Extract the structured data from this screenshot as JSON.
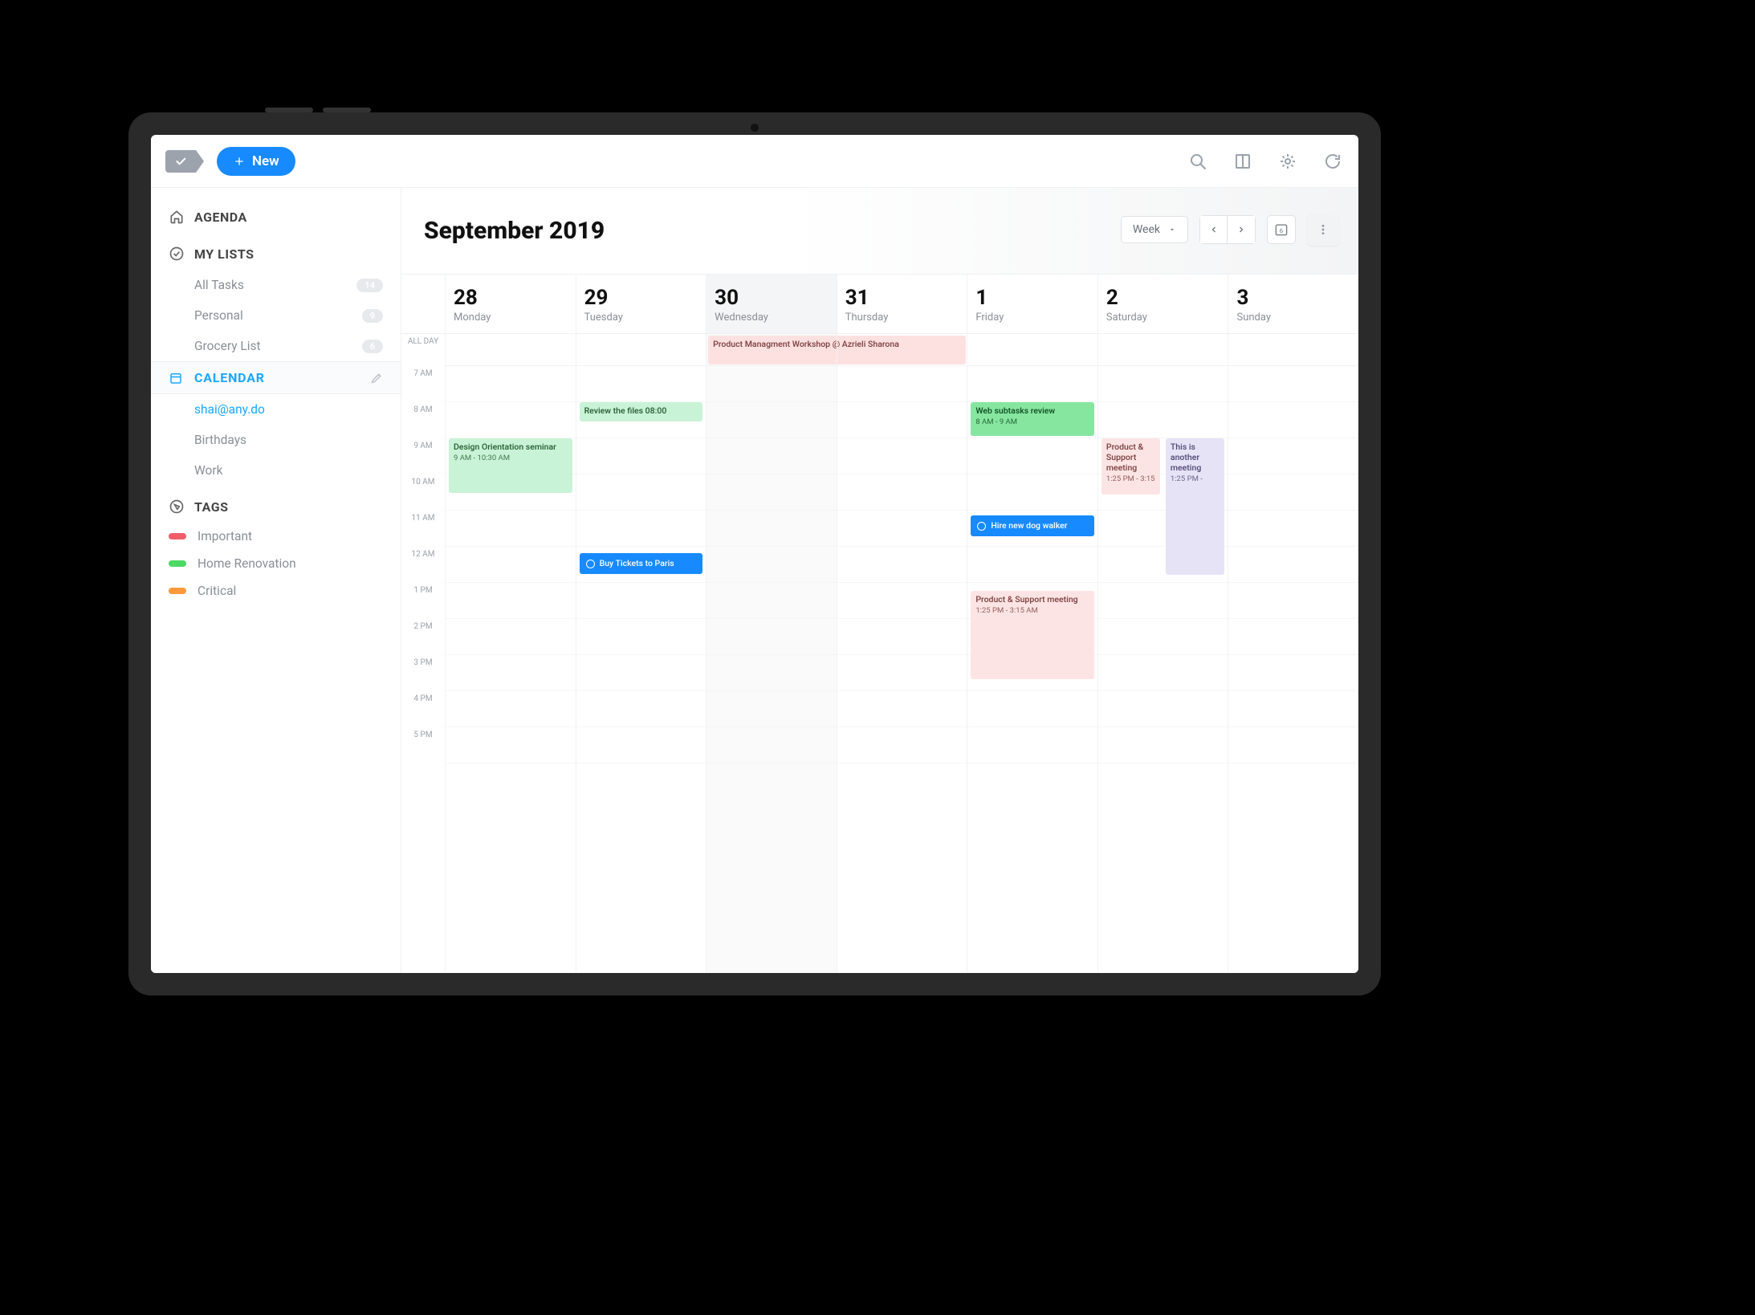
{
  "toolbar": {
    "new_label": "New"
  },
  "sidebar": {
    "agenda_label": "AGENDA",
    "mylists_label": "MY LISTS",
    "lists": [
      {
        "label": "All Tasks",
        "count": "14"
      },
      {
        "label": "Personal",
        "count": "9"
      },
      {
        "label": "Grocery List",
        "count": "6"
      }
    ],
    "calendar_label": "CALENDAR",
    "calendars": [
      {
        "label": "shai@any.do",
        "accent": true
      },
      {
        "label": "Birthdays",
        "accent": false
      },
      {
        "label": "Work",
        "accent": false
      }
    ],
    "tags_label": "TAGS",
    "tags": [
      {
        "label": "Important",
        "color": "#f15d6a"
      },
      {
        "label": "Home Renovation",
        "color": "#4cd964"
      },
      {
        "label": "Critical",
        "color": "#ff9a3c"
      }
    ]
  },
  "calendar": {
    "title": "September 2019",
    "view_label": "Week",
    "today_icon_value": "6",
    "allday_label": "ALL DAY",
    "hours": [
      "7 AM",
      "8 AM",
      "9 AM",
      "10 AM",
      "11 AM",
      "12 AM",
      "1 PM",
      "2 PM",
      "3 PM",
      "4 PM",
      "5 PM"
    ],
    "days": [
      {
        "num": "28",
        "dow": "Monday",
        "today": false
      },
      {
        "num": "29",
        "dow": "Tuesday",
        "today": false
      },
      {
        "num": "30",
        "dow": "Wednesday",
        "today": true
      },
      {
        "num": "31",
        "dow": "Thursday",
        "today": false
      },
      {
        "num": "1",
        "dow": "Friday",
        "today": false
      },
      {
        "num": "2",
        "dow": "Saturday",
        "today": false
      },
      {
        "num": "3",
        "dow": "Sunday",
        "today": false
      }
    ],
    "events": {
      "mon_design": {
        "title": "Design Orientation seminar",
        "time": "9 AM - 10:30 AM"
      },
      "tue_review": {
        "title": "Review the files 08:00"
      },
      "tue_paris": {
        "title": "Buy Tickets to Paris"
      },
      "wed_workshop": {
        "title": "Product Managment Workshop @ Azrieli Sharona"
      },
      "fri_web": {
        "title": "Web subtasks review",
        "time": "8 AM - 9 AM"
      },
      "fri_dog": {
        "title": "Hire new dog walker"
      },
      "fri_prod": {
        "title": "Product & Support meeting",
        "time": "1:25 PM - 3:15 AM"
      },
      "sat_prod": {
        "title": "Product & Support meeting",
        "time": "1:25 PM - 3:15"
      },
      "sat_other": {
        "title": "This is another meeting",
        "time": "1:25 PM -"
      }
    }
  }
}
